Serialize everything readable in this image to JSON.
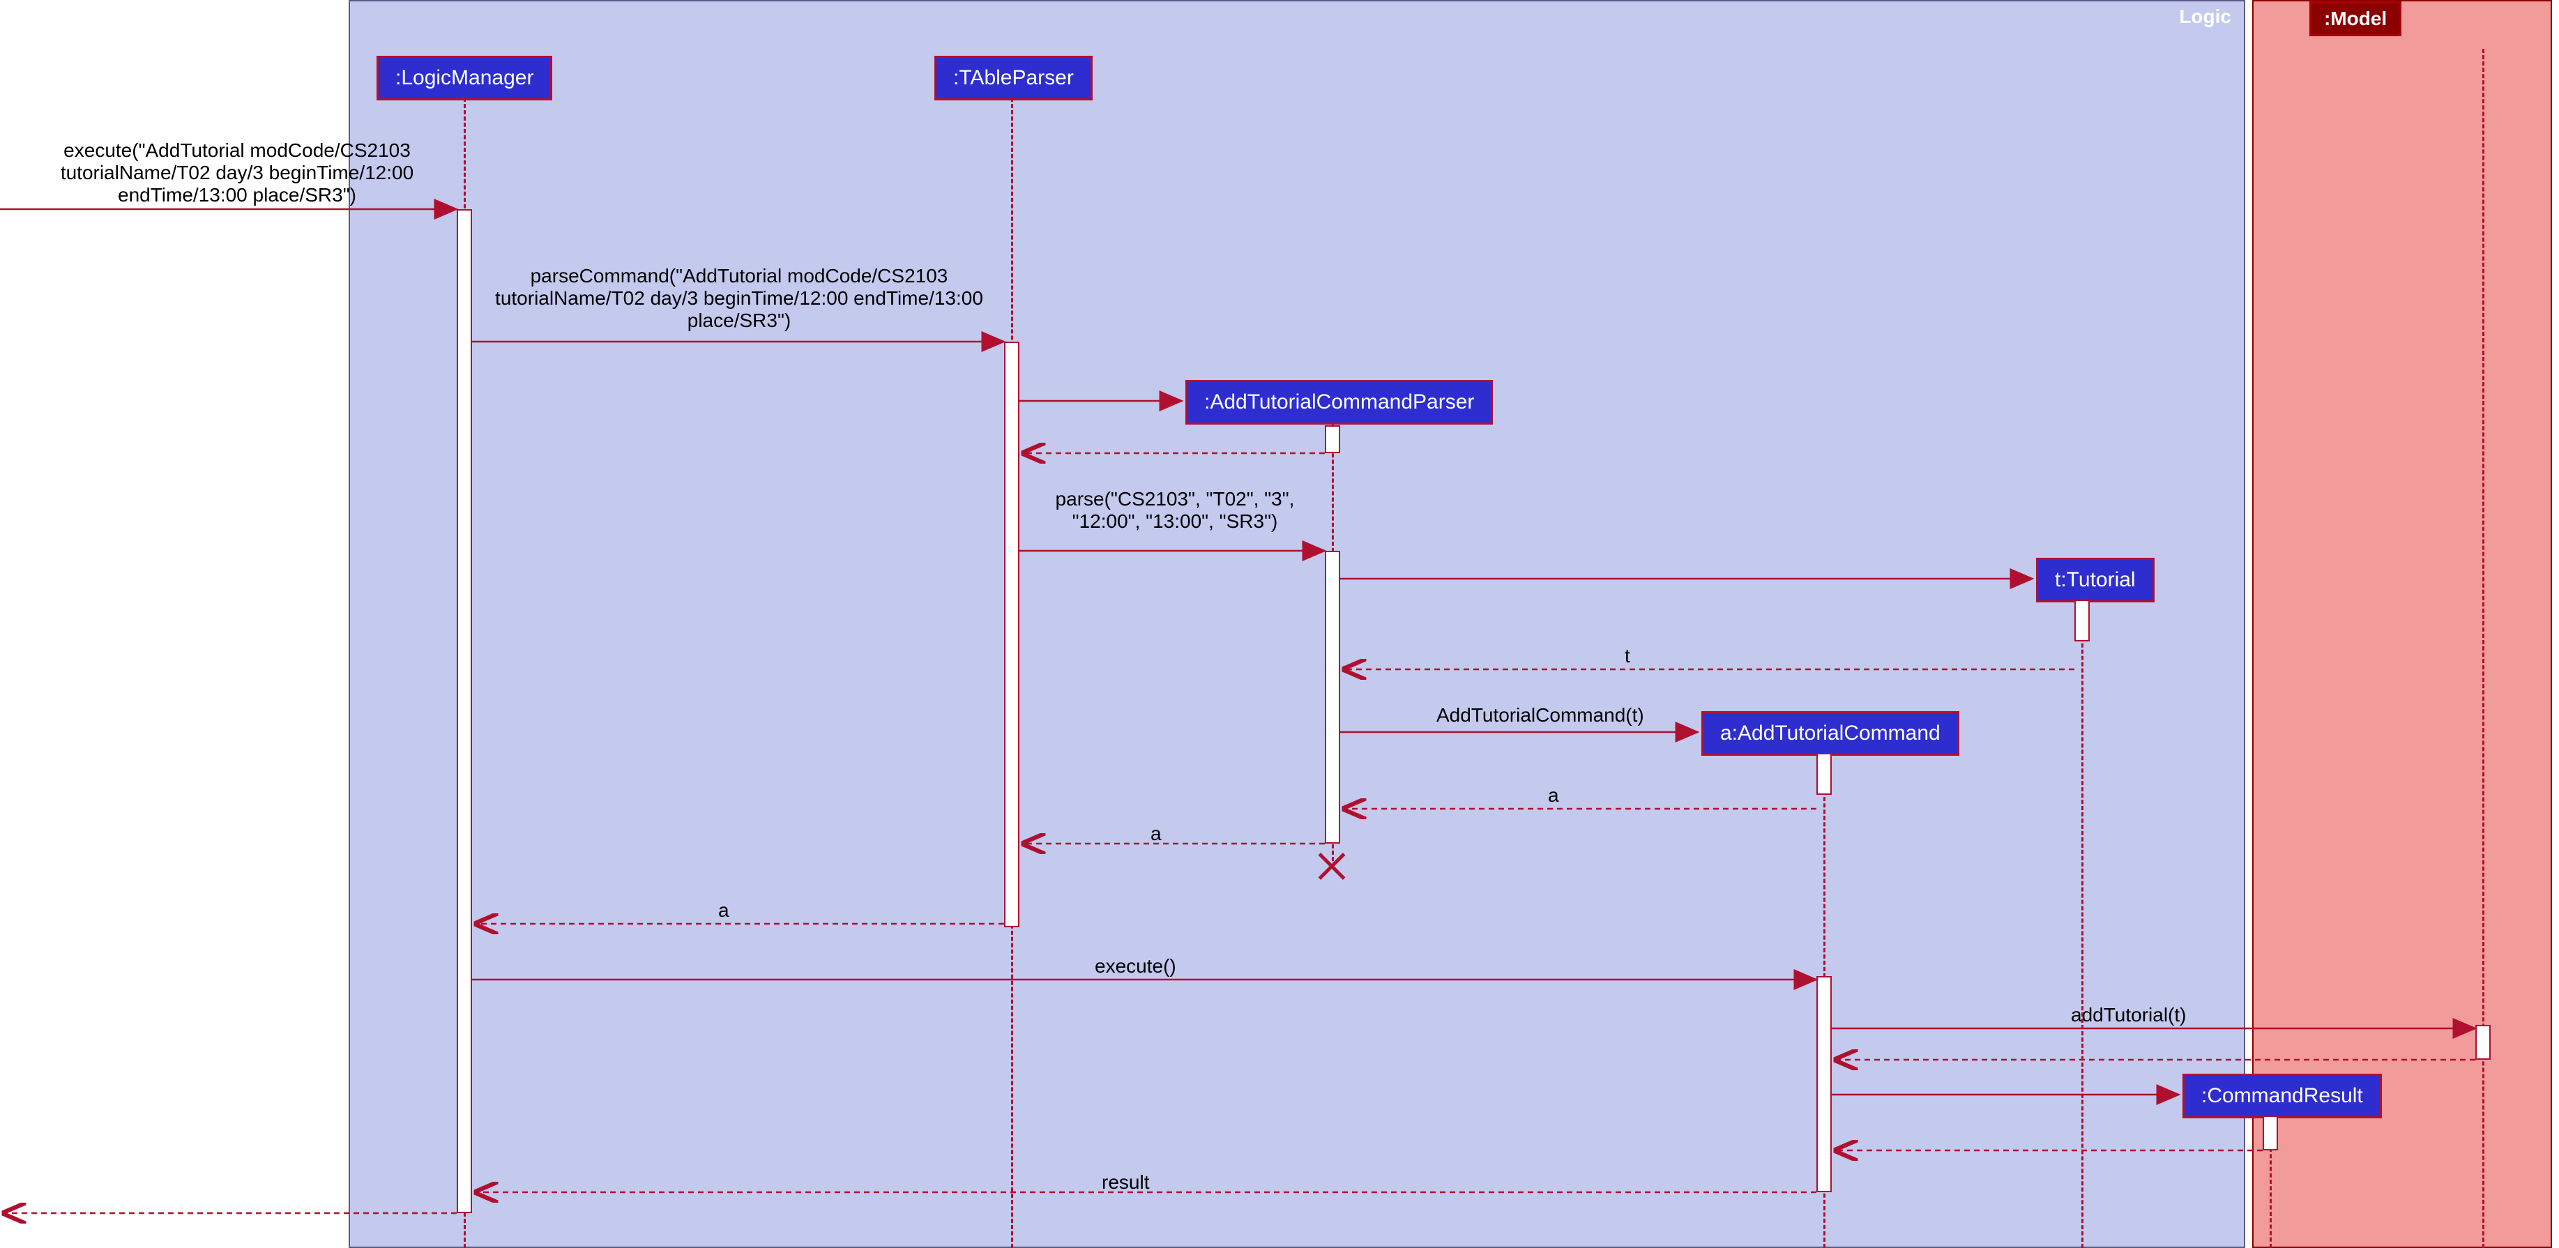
{
  "frames": {
    "logic": "Logic",
    "model": "Model"
  },
  "participants": {
    "logicManager": ":LogicManager",
    "tableParser": ":TAbleParser",
    "addTutorialCommandParser": ":AddTutorialCommandParser",
    "tutorial": "t:Tutorial",
    "addTutorialCommand": "a:AddTutorialCommand",
    "commandResult": ":CommandResult",
    "model": ":Model"
  },
  "messages": {
    "execute_in": "execute(\"AddTutorial modCode/CS2103 tutorialName/T02 day/3 beginTime/12:00 endTime/13:00 place/SR3\")",
    "parseCommand": "parseCommand(\"AddTutorial modCode/CS2103 tutorialName/T02 day/3 beginTime/12:00 endTime/13:00 place/SR3\")",
    "parse": "parse(\"CS2103\", \"T02\", \"3\", \"12:00\", \"13:00\", \"SR3\")",
    "return_t": "t",
    "addTutorialCommand_t": "AddTutorialCommand(t)",
    "return_a1": "a",
    "return_a2": "a",
    "return_a3": "a",
    "execute_call": "execute()",
    "addTutorial": "addTutorial(t)",
    "return_result": "result"
  }
}
